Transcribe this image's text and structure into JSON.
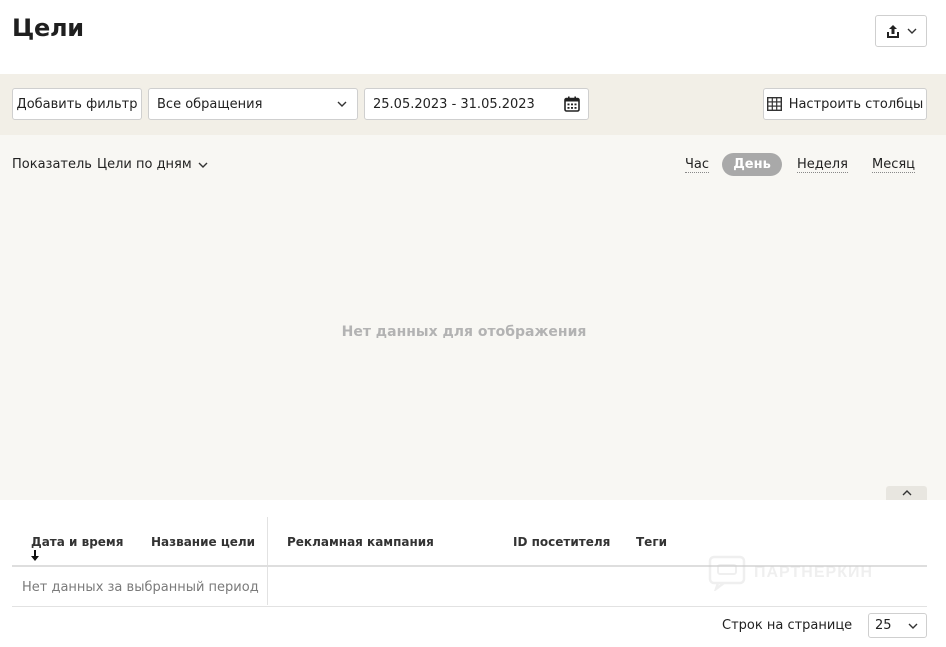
{
  "header": {
    "title": "Цели",
    "export_icon": "share-upload-icon"
  },
  "filters": {
    "add_filter_label": "Добавить фильтр",
    "appeals_value": "Все обращения",
    "date_range_value": "25.05.2023 - 31.05.2023",
    "configure_columns_label": "Настроить столбцы"
  },
  "chart": {
    "metric_label": "Показатель",
    "metric_value": "Цели по дням",
    "periods": {
      "hour": "Час",
      "day": "День",
      "week": "Неделя",
      "month": "Месяц"
    },
    "active_period": "day",
    "empty_message": "Нет данных для отображения"
  },
  "table": {
    "columns": [
      "Дата и время",
      "Название цели",
      "Рекламная кампания",
      "ID посетителя",
      "Теги"
    ],
    "empty_message": "Нет данных за выбранный период"
  },
  "pagination": {
    "rows_per_page_label": "Строк на странице",
    "rows_per_page_value": "25"
  },
  "watermark": {
    "text": "ПАРТНЕРКИН"
  },
  "colors": {
    "filter_bar_bg": "#f2efe7",
    "chart_bg": "#f8f7f3",
    "active_pill": "#a9a9a9"
  }
}
